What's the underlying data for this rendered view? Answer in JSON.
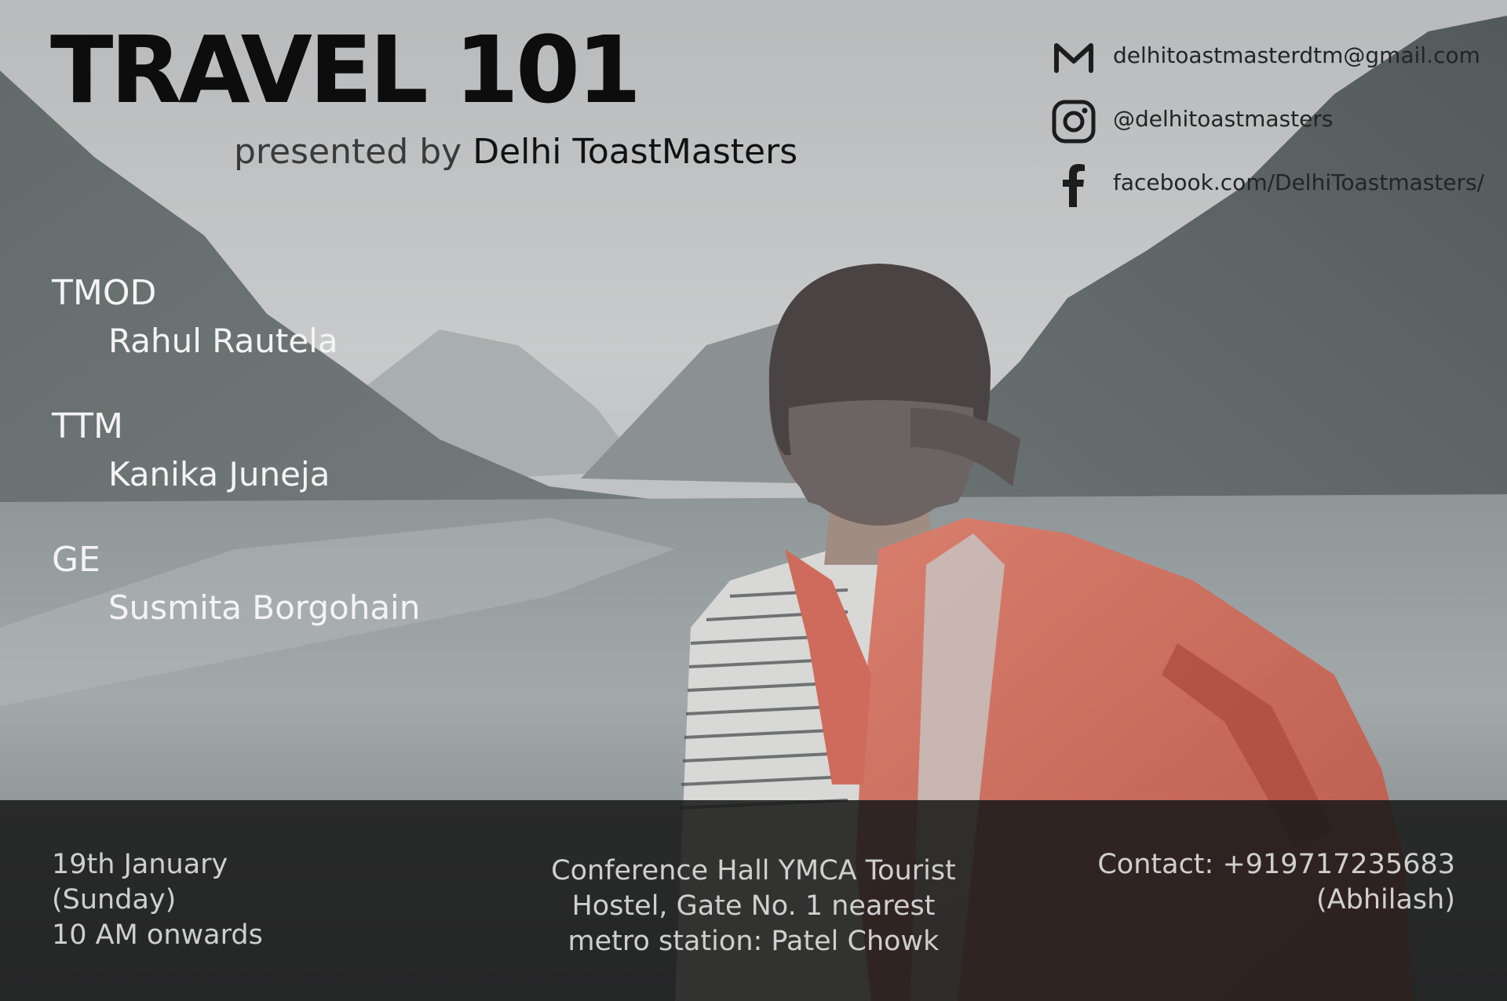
{
  "title": "TRAVEL 101",
  "subtitle": {
    "prefix": "presented by ",
    "organizer": "Delhi ToastMasters"
  },
  "contacts": [
    {
      "icon": "gmail-icon",
      "text": "delhitoastmasterdtm@gmail.com"
    },
    {
      "icon": "instagram-icon",
      "text": "@delhitoastmasters"
    },
    {
      "icon": "facebook-icon",
      "text": "facebook.com/DelhiToastmasters/"
    }
  ],
  "roles": [
    {
      "role": "TMOD",
      "name": "Rahul Rautela"
    },
    {
      "role": "TTM",
      "name": "Kanika Juneja"
    },
    {
      "role": "GE",
      "name": "Susmita Borgohain"
    }
  ],
  "footer": {
    "date_lines": [
      "19th January",
      "(Sunday)",
      "10 AM onwards"
    ],
    "venue_lines": [
      "Conference Hall YMCA Tourist",
      "Hostel, Gate No. 1 nearest",
      "metro station: Patel Chowk"
    ],
    "contact_lines": [
      "Contact: +919717235683",
      "(Abhilash)"
    ]
  },
  "colors": {
    "title": "#0d0d0d",
    "role_text": "#f4f4f4",
    "footer_bg": "#1a1a1a",
    "footer_text": "#cfcfcf",
    "backpack": "#c9695a"
  }
}
